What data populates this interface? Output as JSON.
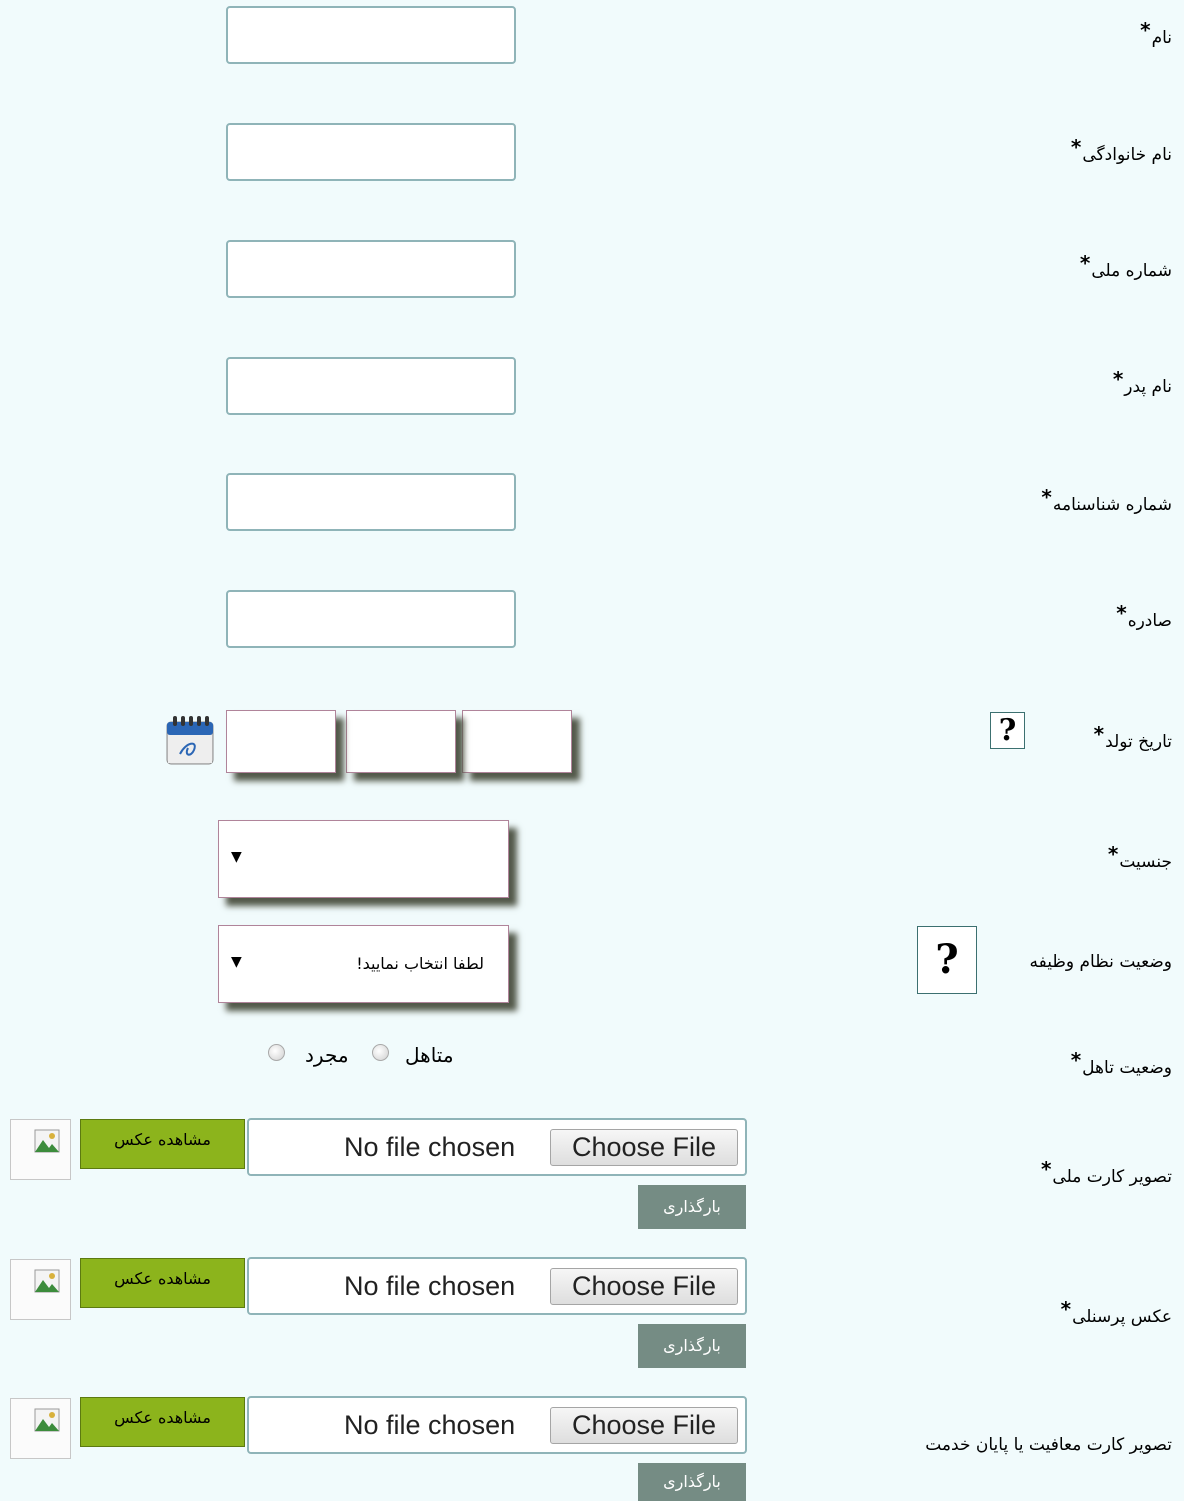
{
  "required_mark": "*",
  "fields": {
    "first_name": {
      "label": "نام"
    },
    "last_name": {
      "label": "نام خانوادگی"
    },
    "national_code": {
      "label": "شماره ملی"
    },
    "father_name": {
      "label": "نام پدر"
    },
    "id_number": {
      "label": "شماره شناسنامه"
    },
    "issued": {
      "label": "صادره"
    },
    "birth_date": {
      "label": "تاریخ تولد",
      "help": "?"
    },
    "gender": {
      "label": "جنسیت",
      "selected": ""
    },
    "military": {
      "label": "وضعیت نظام وظیفه",
      "help": "?",
      "selected": "لطفا انتخاب نمایید!"
    },
    "marital": {
      "label": "وضعیت تاهل",
      "options": [
        "متاهل",
        "مجرد"
      ]
    }
  },
  "uploads": [
    {
      "label": "تصویر کارت ملی",
      "required": true,
      "no_file": "No file chosen",
      "choose": "Choose File",
      "view": "مشاهده عکس",
      "upload": "بارگذاری"
    },
    {
      "label": "عکس پرسنلی",
      "required": true,
      "no_file": "No file chosen",
      "choose": "Choose File",
      "view": "مشاهده عکس",
      "upload": "بارگذاری"
    },
    {
      "label": "تصویر کارت معافیت یا پایان خدمت",
      "required": false,
      "no_file": "No file chosen",
      "choose": "Choose File",
      "view": "مشاهده عکس",
      "upload": "بارگذاری"
    }
  ],
  "icons": {
    "calendar": "calendar-icon",
    "broken_image": "broken-image-icon"
  },
  "colors": {
    "background": "#f1fbfc",
    "view_button": "#8cb41c",
    "upload_button": "#758c84"
  }
}
